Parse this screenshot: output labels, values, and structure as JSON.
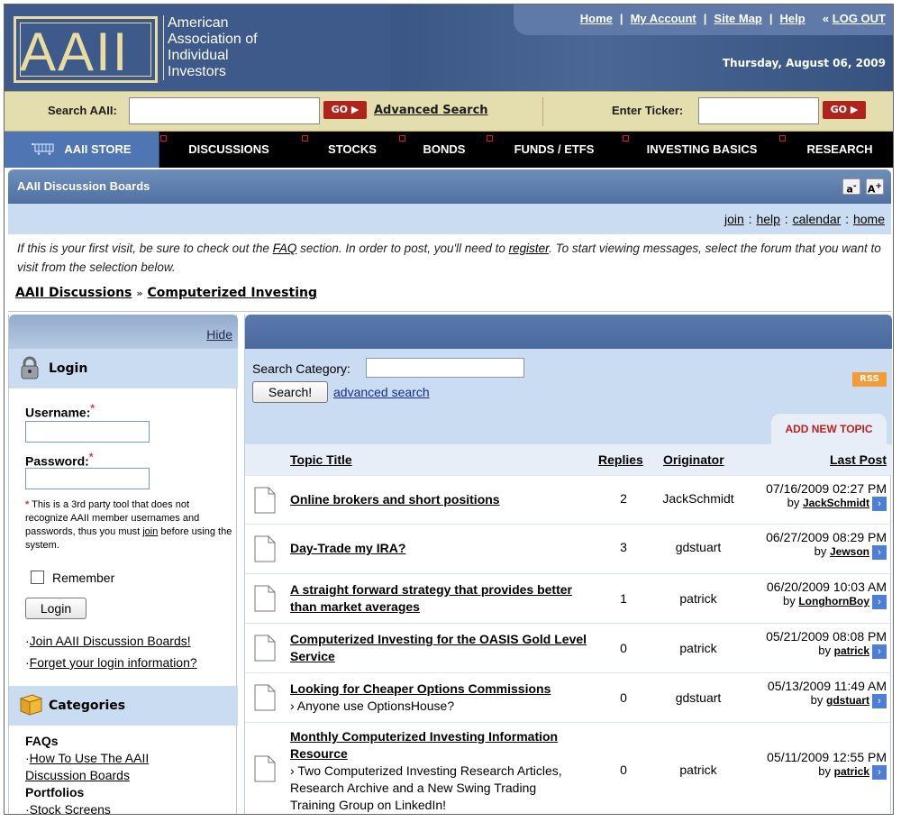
{
  "header": {
    "logo_text": "AAII",
    "org_name_lines": [
      "American",
      "Association of",
      "Individual",
      "Investors"
    ],
    "top_links": [
      "Home",
      "My Account",
      "Site Map",
      "Help",
      "LOG OUT"
    ],
    "logout_prefix": "«",
    "date": "Thursday, August 06, 2009"
  },
  "searchbar": {
    "search_label": "Search AAII:",
    "go_label": "GO",
    "advanced_label": "Advanced Search",
    "ticker_label": "Enter Ticker:",
    "ticker_go_label": "GO"
  },
  "nav": {
    "items": [
      "AAII STORE",
      "DISCUSSIONS",
      "STOCKS",
      "BONDS",
      "FUNDS / ETFS",
      "INVESTING BASICS",
      "RESEARCH"
    ]
  },
  "board": {
    "title": "AAII Discussion Boards",
    "font_smaller": "a",
    "font_larger": "A",
    "links": [
      "join",
      "help",
      "calendar",
      "home"
    ],
    "intro_1": "If this is your first visit, be sure to check out the ",
    "intro_faq": "FAQ",
    "intro_2": " section. In order to post, you'll need to ",
    "intro_register": "register",
    "intro_3": ". To start viewing messages, select the forum that you want to visit from the selection below.",
    "breadcrumb": [
      "AAII Discussions",
      "Computerized Investing"
    ],
    "breadcrumb_sep": "»"
  },
  "sidebar": {
    "hide_label": "Hide",
    "login_title": "Login",
    "username_label": "Username:",
    "password_label": "Password:",
    "required_mark": "*",
    "note_1": "This is a 3rd party tool that does not recognize AAII member usernames and passwords, thus you must ",
    "note_join": "join",
    "note_2": " before using the system.",
    "remember_label": "Remember",
    "login_button": "Login",
    "join_link": "Join AAII Discussion Boards!",
    "forgot_link": "Forget your login information?",
    "categories_title": "Categories",
    "categories": [
      {
        "type": "group",
        "text": "FAQs"
      },
      {
        "type": "link",
        "text": "How To Use The AAII Discussion Boards"
      },
      {
        "type": "group",
        "text": "Portfolios"
      },
      {
        "type": "link",
        "text": "Stock Screens"
      }
    ]
  },
  "main": {
    "search_label": "Search Category:",
    "search_button": "Search!",
    "advanced_link": "advanced search",
    "rss_label": "RSS",
    "add_topic_label": "ADD NEW TOPIC",
    "columns": [
      "Topic Title",
      "Replies",
      "Originator",
      "Last Post"
    ],
    "by_prefix": "by",
    "topics": [
      {
        "title": "Online brokers and short positions",
        "sub": "",
        "replies": "2",
        "originator": "JackSchmidt",
        "date": "07/16/2009 02:27 PM",
        "by": "JackSchmidt"
      },
      {
        "title": "Day-Trade my IRA?",
        "sub": "",
        "replies": "3",
        "originator": "gdstuart",
        "date": "06/27/2009 08:29 PM",
        "by": "Jewson"
      },
      {
        "title": "A straight forward strategy that provides better than market averages",
        "sub": "",
        "replies": "1",
        "originator": "patrick",
        "date": "06/20/2009 10:03 AM",
        "by": "LonghornBoy"
      },
      {
        "title": "Computerized Investing for the OASIS Gold Level Service",
        "sub": "",
        "replies": "0",
        "originator": "patrick",
        "date": "05/21/2009 08:08 PM",
        "by": "patrick"
      },
      {
        "title": "Looking for Cheaper Options Commissions",
        "sub": "Anyone use OptionsHouse?",
        "replies": "0",
        "originator": "gdstuart",
        "date": "05/13/2009 11:49 AM",
        "by": "gdstuart"
      },
      {
        "title": "Monthly Computerized Investing Information Resource",
        "sub": "Two Computerized Investing Research Articles, Research Archive and a New Swing Trading Training Group on LinkedIn!",
        "replies": "0",
        "originator": "patrick",
        "date": "05/11/2009 12:55 PM",
        "by": "patrick"
      }
    ]
  },
  "colors": {
    "header_blue": "#3e5a8a",
    "logo_cream": "#e9dca0",
    "search_tan": "#e4deae",
    "go_red": "#b0241e",
    "store_blue": "#4f76b3",
    "panel_light_blue": "#c9dcf1",
    "rss_orange": "#f49a36"
  },
  "icons": [
    "lock-icon",
    "book-icon",
    "document-icon",
    "arrow-right-icon",
    "store-icon"
  ]
}
